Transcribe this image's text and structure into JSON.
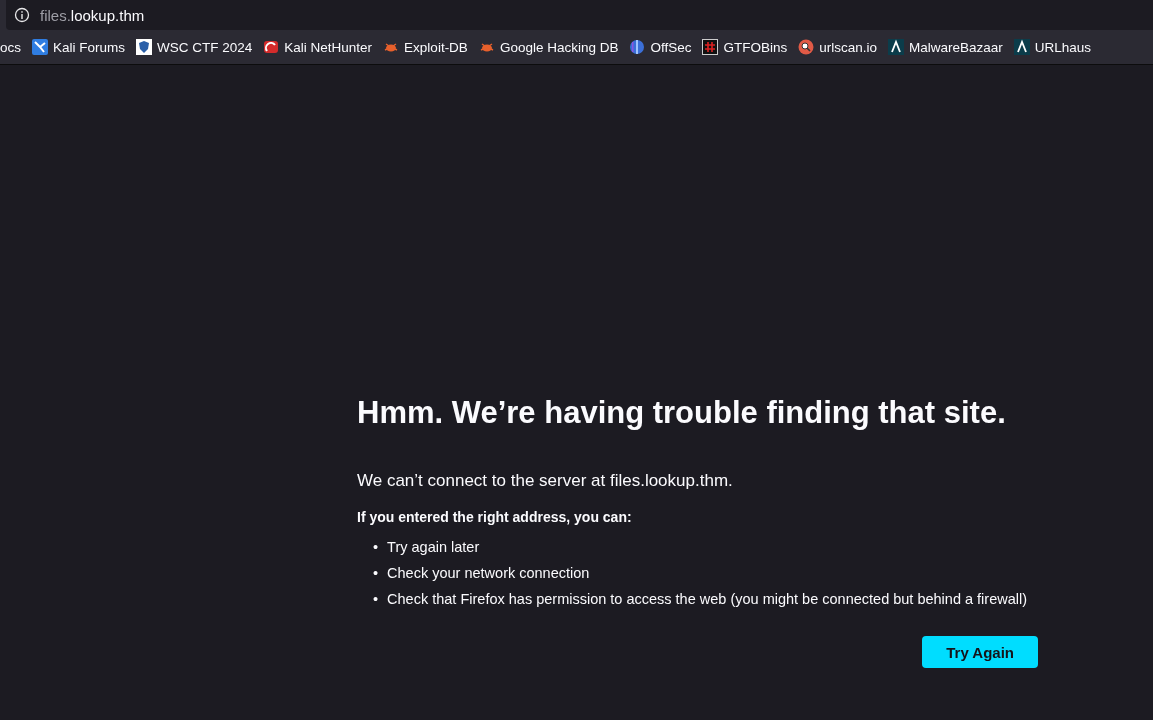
{
  "address_bar": {
    "subdomain": "files.",
    "domain": "lookup.thm"
  },
  "bookmarks": [
    {
      "label": "ocs",
      "kind": "none"
    },
    {
      "label": "Kali Forums",
      "kind": "kali"
    },
    {
      "label": "WSC CTF 2024",
      "kind": "shield"
    },
    {
      "label": "Kali NetHunter",
      "kind": "nethunter"
    },
    {
      "label": "Exploit-DB",
      "kind": "bug"
    },
    {
      "label": "Google Hacking DB",
      "kind": "bug"
    },
    {
      "label": "OffSec",
      "kind": "offsec"
    },
    {
      "label": "GTFOBins",
      "kind": "grid"
    },
    {
      "label": "urlscan.io",
      "kind": "lens"
    },
    {
      "label": "MalwareBazaar",
      "kind": "lambda"
    },
    {
      "label": "URLhaus",
      "kind": "lambda"
    }
  ],
  "error": {
    "title": "Hmm. We’re having trouble finding that site.",
    "message": "We can’t connect to the server at files.lookup.thm.",
    "hint_heading": "If you entered the right address, you can:",
    "suggestions": [
      "Try again later",
      "Check your network connection",
      "Check that Firefox has permission to access the web (you might be connected but behind a firewall)"
    ],
    "bullet": "•",
    "button": "Try Again"
  }
}
